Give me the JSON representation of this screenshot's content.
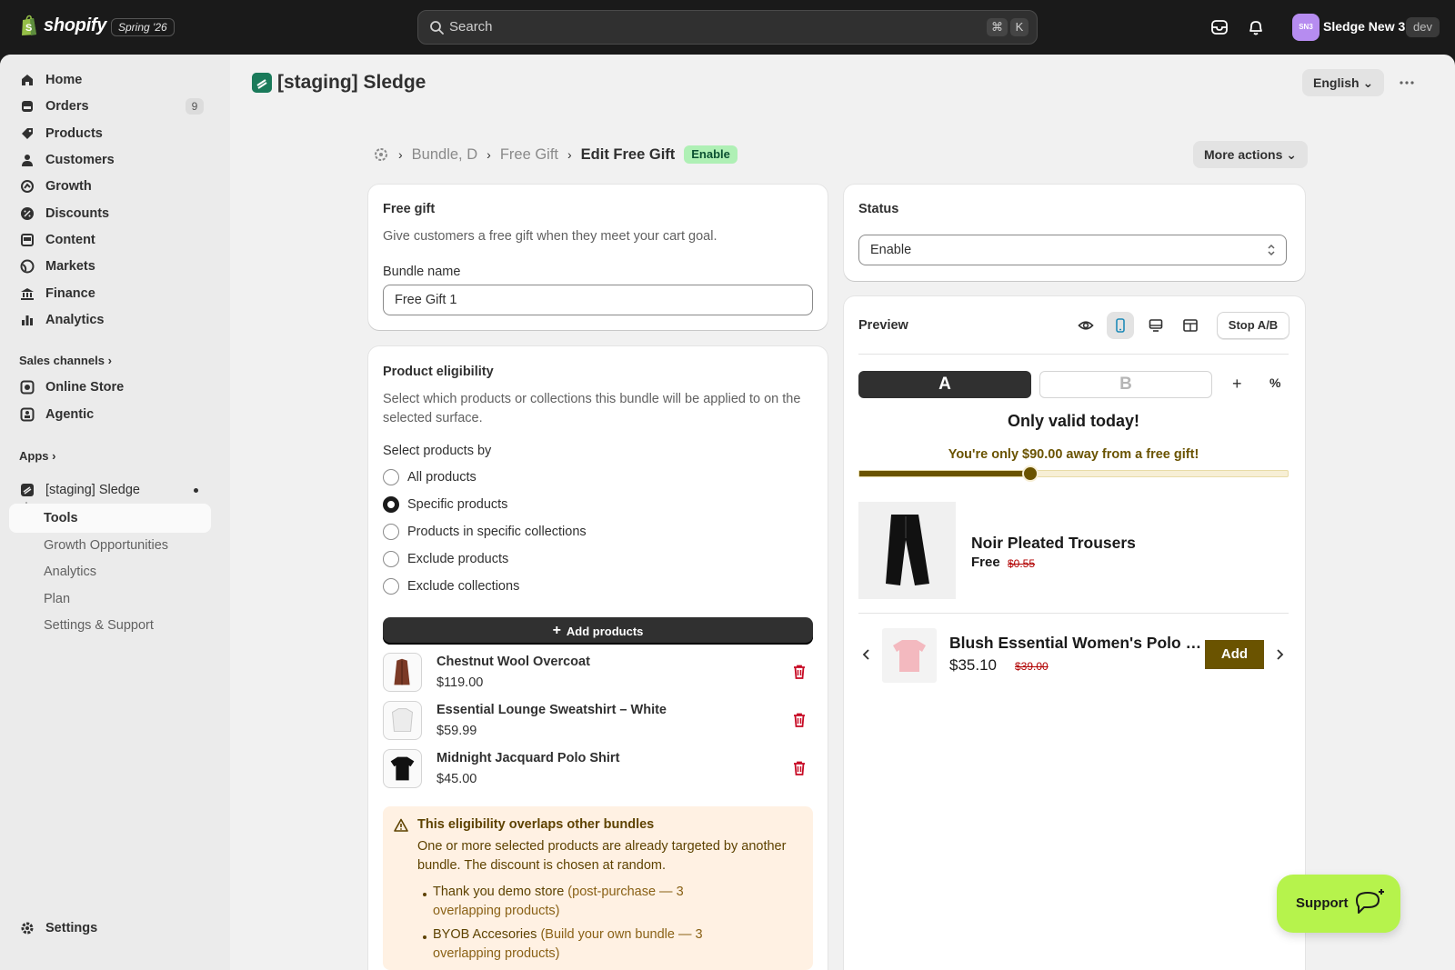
{
  "topbar": {
    "brand": "shopify",
    "edition": "Spring '26",
    "search_placeholder": "Search",
    "shortcut_mod": "⌘",
    "shortcut_key": "K",
    "avatar_initials": "SN3",
    "store_name": "Sledge New 3",
    "env_badge": "dev"
  },
  "sidebar": {
    "items": [
      {
        "label": "Home",
        "icon": "home-icon"
      },
      {
        "label": "Orders",
        "icon": "orders-icon",
        "count": "9"
      },
      {
        "label": "Products",
        "icon": "tag-icon"
      },
      {
        "label": "Customers",
        "icon": "person-icon"
      },
      {
        "label": "Growth",
        "icon": "growth-icon"
      },
      {
        "label": "Discounts",
        "icon": "discount-icon"
      },
      {
        "label": "Content",
        "icon": "content-icon"
      },
      {
        "label": "Markets",
        "icon": "globe-icon"
      },
      {
        "label": "Finance",
        "icon": "bank-icon"
      },
      {
        "label": "Analytics",
        "icon": "bar-chart-icon"
      }
    ],
    "sales_channels_label": "Sales channels",
    "channels": [
      {
        "label": "Online Store",
        "icon": "store-icon"
      },
      {
        "label": "Agentic",
        "icon": "agent-icon"
      }
    ],
    "apps_label": "Apps",
    "app_name": "[staging] Sledge",
    "app_subitems": [
      "Tools",
      "Growth Opportunities",
      "Analytics",
      "Plan",
      "Settings & Support"
    ],
    "settings_label": "Settings"
  },
  "header": {
    "app_title": "[staging] Sledge",
    "language": "English"
  },
  "breadcrumb": {
    "crumb1": "Bundle, D",
    "crumb2": "Free Gift",
    "current": "Edit Free Gift",
    "status_badge": "Enable",
    "more_actions": "More actions"
  },
  "free_gift_card": {
    "title": "Free gift",
    "description": "Give customers a free gift when they meet your cart goal.",
    "bundle_name_label": "Bundle name",
    "bundle_name_value": "Free Gift 1"
  },
  "eligibility_card": {
    "title": "Product eligibility",
    "description": "Select which products or collections this bundle will be applied to on the selected surface.",
    "select_by_label": "Select products by",
    "options": [
      {
        "label": "All products",
        "selected": false
      },
      {
        "label": "Specific products",
        "selected": true
      },
      {
        "label": "Products in specific collections",
        "selected": false
      },
      {
        "label": "Exclude products",
        "selected": false
      },
      {
        "label": "Exclude collections",
        "selected": false
      }
    ],
    "add_products_label": "Add products",
    "products": [
      {
        "name": "Chestnut Wool Overcoat",
        "price": "$119.00",
        "color": "#7b3a26"
      },
      {
        "name": "Essential Lounge Sweatshirt – White",
        "price": "$59.99",
        "color": "#e6e6e6"
      },
      {
        "name": "Midnight Jacquard Polo Shirt",
        "price": "$45.00",
        "color": "#111111"
      }
    ],
    "warning": {
      "title": "This eligibility overlaps other bundles",
      "text": "One or more selected products are already targeted by another bundle. The discount is chosen at random.",
      "items": [
        {
          "name": "Thank you demo store",
          "detail": " (post-purchase — 3 overlapping products)"
        },
        {
          "name": "BYOB Accesories",
          "detail": " (Build your own bundle — 3 overlapping products)"
        }
      ]
    }
  },
  "status_card": {
    "title": "Status",
    "value": "Enable"
  },
  "preview_card": {
    "title": "Preview",
    "stop_ab_label": "Stop A/B",
    "variant_a": "A",
    "variant_b": "B",
    "headline": "Only valid today!",
    "goal_text": "You're only $90.00 away from a free gift!",
    "progress": 0.4,
    "gift": {
      "name": "Noir Pleated Trousers",
      "price": "Free",
      "old_price": "$0.55"
    },
    "upsell": {
      "name": "Blush Essential Women's Polo Shirt",
      "price": "$35.10",
      "old_price": "$39.00",
      "add_label": "Add"
    },
    "accent_color": "#6a5300"
  },
  "support_widget": {
    "label": "Support"
  }
}
